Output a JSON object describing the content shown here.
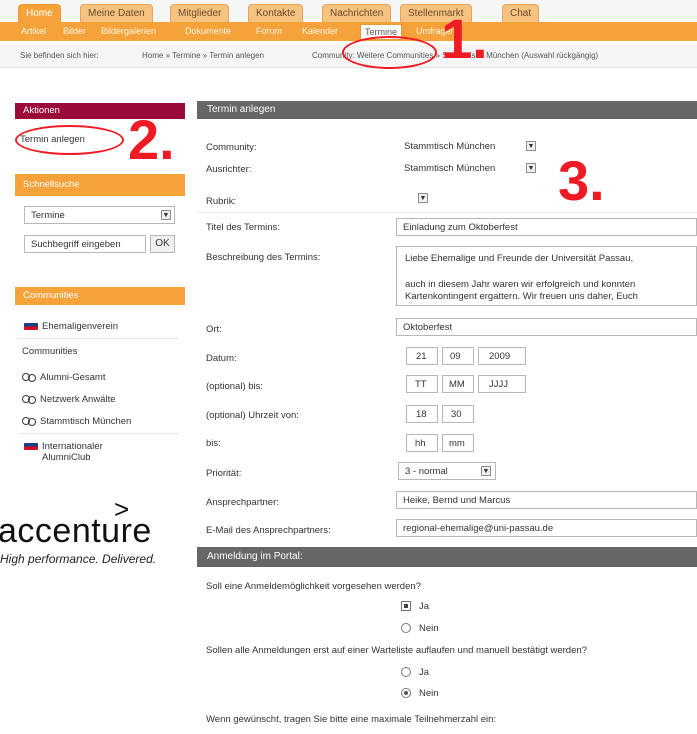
{
  "nav": {
    "tabs": [
      "Home",
      "Meine Daten",
      "Mitglieder",
      "Kontakte",
      "Nachrichten",
      "Stellenmarkt",
      "Chat"
    ],
    "subtabs": [
      "Artikel",
      "Bilder",
      "Bildergalerien",
      "Dokumente",
      "Forum",
      "Kalender",
      "Termine",
      "Umfragen"
    ],
    "active_tab": "Home",
    "active_subtab": "Termine"
  },
  "breadcrumb": {
    "label": "Sie befinden sich hier:",
    "path": "Home » Termine » Termin anlegen",
    "community_note": "Community: Weitere Communities » Stammtisch München (Auswahl rückgängig)"
  },
  "left": {
    "aktionen": {
      "heading": "Aktionen",
      "item": "Termin anlegen"
    },
    "schnellsuche": {
      "heading": "Schnellsuche",
      "select_value": "Termine",
      "search_placeholder": "Suchbegriff eingeben",
      "ok_label": "OK"
    },
    "communities": {
      "heading": "Communities",
      "items": [
        {
          "icon": "flag-icon",
          "label": "Ehemaligenverein"
        },
        {
          "icon": "",
          "label": "Communities"
        },
        {
          "icon": "group-icon",
          "label": "Alumni-Gesamt"
        },
        {
          "icon": "group-icon",
          "label": "Netzwerk Anwälte"
        },
        {
          "icon": "group-icon",
          "label": "Stammtisch München"
        },
        {
          "icon": "flag-icon",
          "label": "Internationaler"
        },
        {
          "icon": "",
          "label": "AlumniClub"
        }
      ]
    },
    "logo": {
      "arrow": ">",
      "text": "accenture",
      "tagline": "High performance. Delivered."
    }
  },
  "form": {
    "heading": "Termin anlegen",
    "labels": {
      "community": "Community:",
      "ausrichter": "Ausrichter:",
      "rubrik": "Rubrik:",
      "titel": "Titel des Termins:",
      "beschreibung": "Beschreibung des Termins:",
      "ort": "Ort:",
      "datum": "Datum:",
      "optional_bis": "(optional) bis:",
      "optional_uhrzeit_von": "(optional) Uhrzeit von:",
      "bis": "bis:",
      "prioritaet": "Priorität:",
      "ansprechpartner": "Ansprechpartner:",
      "email": "E-Mail des Ansprechpartners:"
    },
    "values": {
      "community": "Stammtisch München",
      "ausrichter": "Stammtisch München",
      "rubrik": "",
      "titel": "Einladung zum Oktoberfest",
      "beschreibung_lines": [
        "Liebe Ehemalige und Freunde der Universität Passau,",
        "",
        "auch in diesem Jahr waren wir erfolgreich und konnten",
        "Kartenkontingent ergattern. Wir freuen uns daher, Euch"
      ],
      "ort": "Oktoberfest",
      "datum": {
        "tt": "21",
        "mm": "09",
        "jjjj": "2009"
      },
      "bis_placeholders": {
        "tt": "TT",
        "mm": "MM",
        "jjjj": "JJJJ"
      },
      "uhrzeit_von": {
        "hh": "18",
        "mm": "30"
      },
      "uhrzeit_bis_placeholders": {
        "hh": "hh",
        "mm": "mm"
      },
      "prioritaet": "3 - normal",
      "ansprechpartner": "Heike, Bernd und Marcus",
      "email": "regional-ehemalige@uni-passau.de"
    }
  },
  "anmeldung": {
    "heading": "Anmeldung im Portal:",
    "q1": "Soll eine Anmeldemöglichkeit vorgesehen werden?",
    "q1_options": [
      {
        "label": "Ja",
        "selected": true
      },
      {
        "label": "Nein",
        "selected": false
      }
    ],
    "q2": "Sollen alle Anmeldungen erst auf einer Warteliste auflaufen und manuell bestätigt werden?",
    "q2_options": [
      {
        "label": "Ja",
        "selected": false
      },
      {
        "label": "Nein",
        "selected": true
      }
    ],
    "q3": "Wenn gewünscht, tragen Sie bitte eine maximale Teilnehmerzahl ein:"
  },
  "annotations": {
    "one": "1.",
    "two": "2.",
    "three": "3."
  },
  "colors": {
    "orange": "#f5a23a",
    "maroon": "#9b0b3a",
    "gray_header": "#666666",
    "annotation_red": "#ee1b24"
  }
}
